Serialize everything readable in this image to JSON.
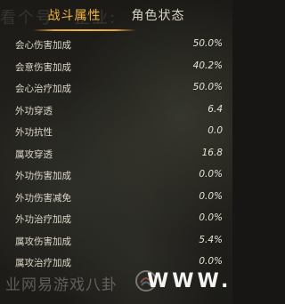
{
  "tabs": [
    {
      "label": "战斗属性",
      "active": true
    },
    {
      "label": "角色状态",
      "active": false
    }
  ],
  "stats": [
    {
      "label": "会心伤害加成",
      "value": "50.0%"
    },
    {
      "label": "会意伤害加成",
      "value": "40.2%"
    },
    {
      "label": "会心治疗加成",
      "value": "50.0%"
    },
    {
      "label": "外功穿透",
      "value": "6.4"
    },
    {
      "label": "外功抗性",
      "value": "0.0"
    },
    {
      "label": "属攻穿透",
      "value": "16.8"
    },
    {
      "label": "外功伤害加成",
      "value": "0.0%"
    },
    {
      "label": "外功伤害减免",
      "value": "0.0%"
    },
    {
      "label": "外功治疗加成",
      "value": "0.0%"
    },
    {
      "label": "属攻伤害加成",
      "value": "5.4%"
    },
    {
      "label": "属攻治疗加成",
      "value": "0.0%"
    }
  ],
  "watermark": {
    "top": "看个号 · 企业:",
    "bottom_cn": "业网易游戏八卦",
    "bottom_en": "WWW."
  },
  "colors": {
    "accent": "#f0b347",
    "text": "#ddd7c7"
  }
}
